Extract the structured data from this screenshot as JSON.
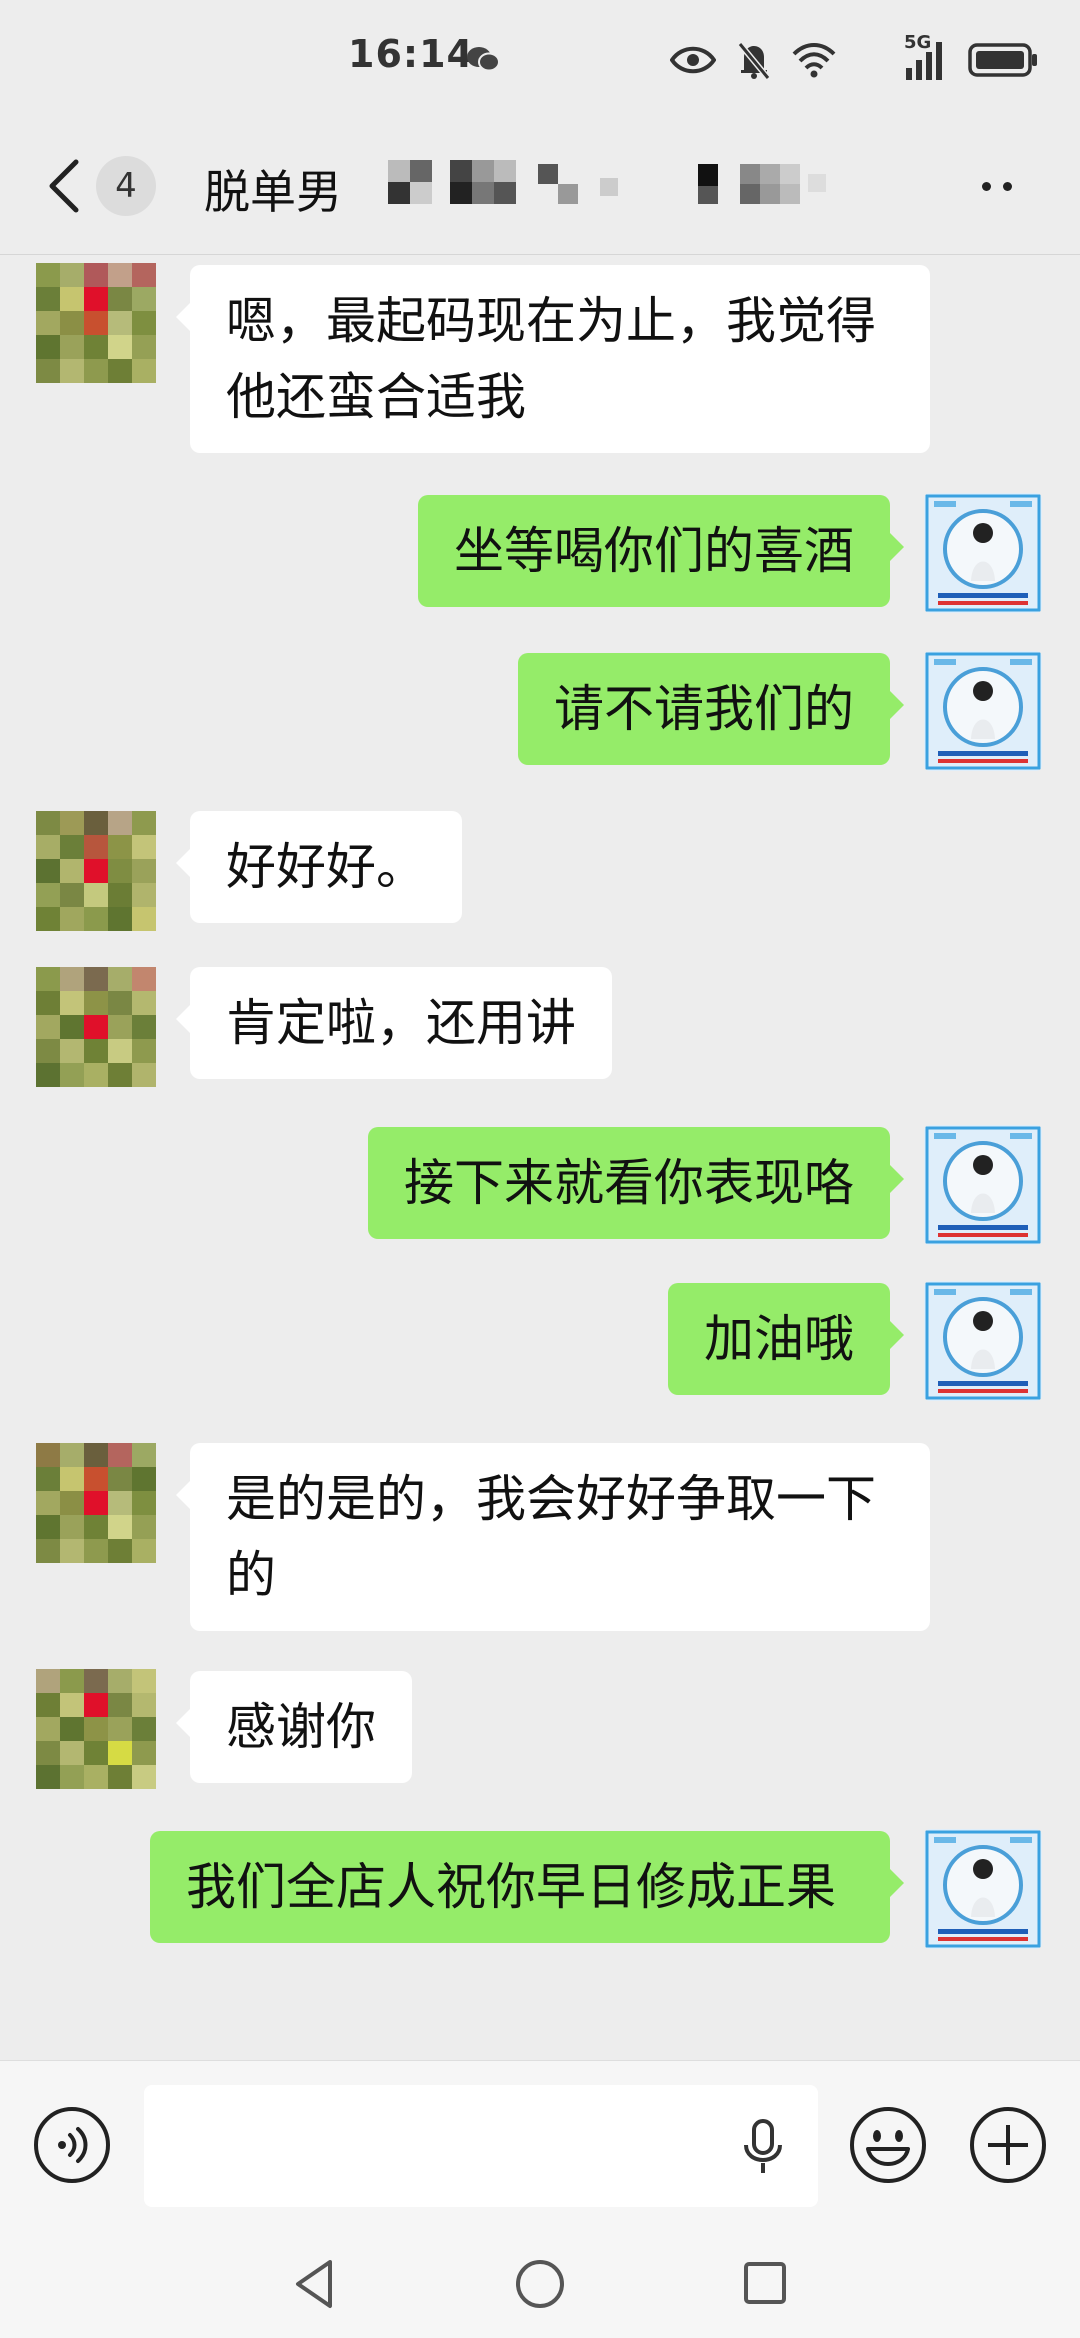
{
  "status_bar": {
    "time": "16:14",
    "network": "5G",
    "icons": [
      "wechat-icon",
      "eye-icon",
      "mute-bell-icon",
      "wifi-icon",
      "signal-icon",
      "battery-icon"
    ]
  },
  "nav": {
    "back_icon": "chevron-left-icon",
    "unread_count": "4",
    "title": "脱单男",
    "more_icon": "more-dots-icon"
  },
  "messages": [
    {
      "from": "them",
      "text": "嗯，最起码现在为止，我觉得他还蛮合适我"
    },
    {
      "from": "me",
      "text": "坐等喝你们的喜酒"
    },
    {
      "from": "me",
      "text": "请不请我们的"
    },
    {
      "from": "them",
      "text": "好好好。"
    },
    {
      "from": "them",
      "text": "肯定啦，还用讲"
    },
    {
      "from": "me",
      "text": "接下来就看你表现咯"
    },
    {
      "from": "me",
      "text": "加油哦"
    },
    {
      "from": "them",
      "text": "是的是的，我会好好争取一下的"
    },
    {
      "from": "them",
      "text": "感谢你"
    },
    {
      "from": "me",
      "text": "我们全店人祝你早日修成正果"
    }
  ],
  "input_bar": {
    "voice_icon": "voice-icon",
    "input_value": "",
    "mic_icon": "mic-icon",
    "emoji_icon": "emoji-icon",
    "add_icon": "plus-icon"
  },
  "system_nav": [
    "back-triangle-icon",
    "home-circle-icon",
    "recents-square-icon"
  ],
  "colors": {
    "background": "#ededed",
    "outgoing_bubble": "#95ec69",
    "incoming_bubble": "#ffffff"
  }
}
